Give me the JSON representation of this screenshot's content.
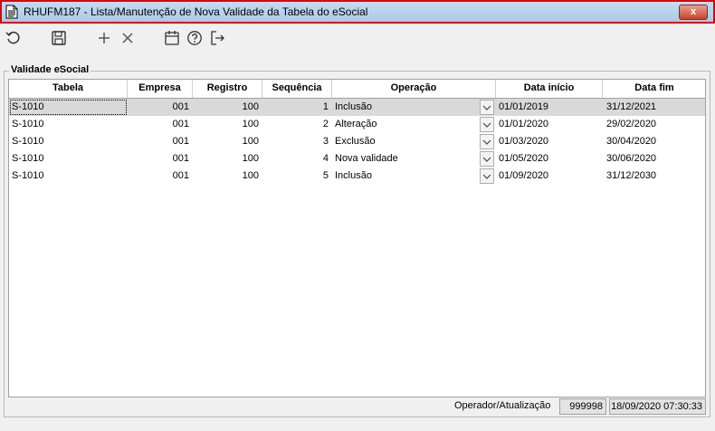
{
  "window": {
    "title": "RHUFM187 - Lista/Manutenção de Nova Validade da Tabela do eSocial",
    "close_label": "x"
  },
  "toolbar": {
    "icons": [
      "refresh-icon",
      "save-icon",
      "add-icon",
      "delete-icon",
      "calendar-icon",
      "help-icon",
      "exit-icon"
    ]
  },
  "group": {
    "label": "Validade eSocial"
  },
  "table": {
    "headers": {
      "tabela": "Tabela",
      "empresa": "Empresa",
      "registro": "Registro",
      "sequencia": "Sequência",
      "operacao": "Operação",
      "data_inicio": "Data início",
      "data_fim": "Data fim"
    },
    "rows": [
      {
        "tabela": "S-1010",
        "empresa": "001",
        "registro": "100",
        "sequencia": "1",
        "operacao": "Inclusão",
        "data_inicio": "01/01/2019",
        "data_fim": "31/12/2021"
      },
      {
        "tabela": "S-1010",
        "empresa": "001",
        "registro": "100",
        "sequencia": "2",
        "operacao": "Alteração",
        "data_inicio": "01/01/2020",
        "data_fim": "29/02/2020"
      },
      {
        "tabela": "S-1010",
        "empresa": "001",
        "registro": "100",
        "sequencia": "3",
        "operacao": "Exclusão",
        "data_inicio": "01/03/2020",
        "data_fim": "30/04/2020"
      },
      {
        "tabela": "S-1010",
        "empresa": "001",
        "registro": "100",
        "sequencia": "4",
        "operacao": "Nova validade",
        "data_inicio": "01/05/2020",
        "data_fim": "30/06/2020"
      },
      {
        "tabela": "S-1010",
        "empresa": "001",
        "registro": "100",
        "sequencia": "5",
        "operacao": "Inclusão",
        "data_inicio": "01/09/2020",
        "data_fim": "31/12/2030"
      }
    ]
  },
  "status": {
    "label": "Operador/Atualização",
    "operator": "999998",
    "updated": "18/09/2020 07:30:33"
  },
  "colors": {
    "title_border": "#e00000",
    "selected_row": "#d9d9d9"
  }
}
